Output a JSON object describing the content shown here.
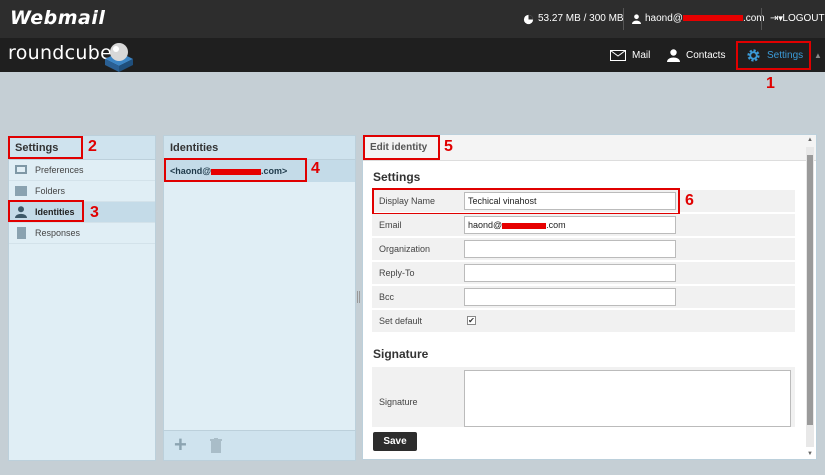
{
  "topbar": {
    "brand": "Webmail",
    "quota": "53.27 MB / 300 MB",
    "user_prefix": "haond@",
    "user_suffix": ".com",
    "logout": "LOGOUT"
  },
  "header": {
    "logo": "roundcube",
    "nav": [
      {
        "label": "Mail",
        "icon": "envelope-icon"
      },
      {
        "label": "Contacts",
        "icon": "person-icon"
      },
      {
        "label": "Settings",
        "icon": "gear-icon"
      }
    ]
  },
  "settings_panel": {
    "title": "Settings",
    "items": [
      {
        "label": "Preferences",
        "icon": "monitor-icon"
      },
      {
        "label": "Folders",
        "icon": "folder-icon"
      },
      {
        "label": "Identities",
        "icon": "person-icon"
      },
      {
        "label": "Responses",
        "icon": "document-icon"
      }
    ]
  },
  "identities_panel": {
    "title": "Identities",
    "item_prefix": "<haond@",
    "item_suffix": ".com>"
  },
  "edit_panel": {
    "title": "Edit identity",
    "settings_heading": "Settings",
    "fields": [
      {
        "label": "Display Name",
        "value": "Techical vinahost"
      },
      {
        "label": "Email",
        "value_prefix": "haond@",
        "value_suffix": ".com"
      },
      {
        "label": "Organization",
        "value": ""
      },
      {
        "label": "Reply-To",
        "value": ""
      },
      {
        "label": "Bcc",
        "value": ""
      },
      {
        "label": "Set default",
        "checked": true
      }
    ],
    "signature_heading": "Signature",
    "signature_label": "Signature",
    "save": "Save"
  },
  "annotations": [
    "1",
    "2",
    "3",
    "4",
    "5",
    "6"
  ],
  "colors": {
    "accent": "#3b9bd8",
    "highlight": "#e00000",
    "topbar": "#2d2d2d"
  }
}
